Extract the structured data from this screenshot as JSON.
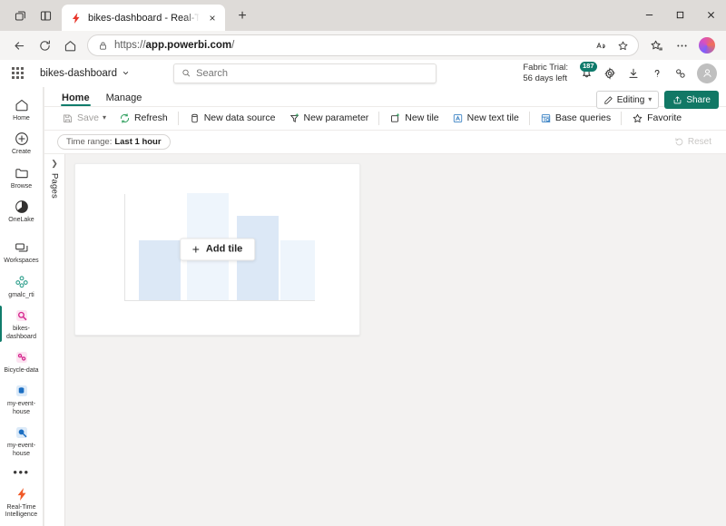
{
  "browser": {
    "tab_title": "bikes-dashboard - Real-Time Inte",
    "tab_favicon": "lightning-bolt-icon",
    "new_tab_label": "+",
    "close_label": "×",
    "url_prefix": "https://",
    "url_domain": "app.powerbi.com",
    "url_suffix": "/",
    "icons": {
      "collections": "collections-icon",
      "split_screen": "split-screen-icon",
      "back": "back-arrow-icon",
      "refresh": "reload-icon",
      "home": "home-icon",
      "lock": "lock-icon",
      "read_aloud": "read-aloud-icon",
      "favorite": "star-icon",
      "favorites_bar": "favorites-list-icon",
      "settings_more": "ellipsis-icon",
      "copilot": "copilot-icon",
      "minimize": "minimize-icon",
      "maximize": "maximize-icon",
      "close": "close-icon"
    }
  },
  "header": {
    "waffle": "app-launcher-icon",
    "breadcrumb": "bikes-dashboard",
    "breadcrumb_chevron": "chevron-down-icon",
    "search": {
      "placeholder": "Search",
      "value": "",
      "icon": "search-icon"
    },
    "trial_line1": "Fabric Trial:",
    "trial_line2": "56 days left",
    "notification_count": "187",
    "icons": {
      "notifications": "bell-icon",
      "settings": "gear-icon",
      "download": "download-icon",
      "help": "help-icon",
      "feedback": "feedback-icon",
      "account": "avatar-icon"
    }
  },
  "sidebar": {
    "items": [
      {
        "label": "Home",
        "icon": "home-icon",
        "selected": false
      },
      {
        "label": "Create",
        "icon": "plus-circle-icon",
        "selected": false
      },
      {
        "label": "Browse",
        "icon": "folder-icon",
        "selected": false
      },
      {
        "label": "OneLake",
        "icon": "onelake-icon",
        "selected": false
      },
      {
        "label": "Workspaces",
        "icon": "workspaces-icon",
        "selected": false
      },
      {
        "label": "gmalc_rti",
        "icon": "workspace-group-icon",
        "selected": false
      },
      {
        "label": "bikes-dashboard",
        "icon": "realtime-dashboard-icon",
        "selected": true
      },
      {
        "label": "Bicycle-data",
        "icon": "eventstream-icon",
        "selected": false
      },
      {
        "label": "my-event-house",
        "icon": "kql-database-icon",
        "selected": false
      },
      {
        "label": "my-event-house",
        "icon": "eventhouse-icon",
        "selected": false
      }
    ],
    "more_label": "•••",
    "footer": {
      "label": "Real-Time Intelligence",
      "icon": "lightning-bolt-icon"
    }
  },
  "tabs": [
    {
      "label": "Home",
      "active": true
    },
    {
      "label": "Manage",
      "active": false
    }
  ],
  "ribbon": {
    "groups": [
      {
        "buttons": [
          {
            "label": "Save",
            "icon": "save-icon",
            "disabled": true,
            "chevron": true
          },
          {
            "label": "Refresh",
            "icon": "refresh-icon",
            "disabled": false,
            "chevron": false
          }
        ]
      },
      {
        "buttons": [
          {
            "label": "New data source",
            "icon": "database-icon",
            "disabled": false,
            "chevron": false
          },
          {
            "label": "New parameter",
            "icon": "parameter-icon",
            "disabled": false,
            "chevron": false
          }
        ]
      },
      {
        "buttons": [
          {
            "label": "New tile",
            "icon": "new-tile-icon",
            "disabled": false,
            "chevron": false
          },
          {
            "label": "New text tile",
            "icon": "text-tile-icon",
            "disabled": false,
            "chevron": false
          }
        ]
      },
      {
        "buttons": [
          {
            "label": "Base queries",
            "icon": "base-queries-icon",
            "disabled": false,
            "chevron": false
          }
        ]
      },
      {
        "buttons": [
          {
            "label": "Favorite",
            "icon": "star-icon",
            "disabled": false,
            "chevron": false
          }
        ]
      }
    ]
  },
  "actions": {
    "editing_label": "Editing",
    "editing_icon": "pencil-icon",
    "editing_chevron": "chevron-down-icon",
    "share_label": "Share",
    "share_icon": "share-icon"
  },
  "filterbar": {
    "time_range_label": "Time range:",
    "time_range_value": "Last 1 hour",
    "reset_label": "Reset",
    "reset_icon": "reset-icon",
    "reset_disabled": true
  },
  "pages_panel": {
    "label": "Pages",
    "expand_icon": "chevron-right-icon"
  },
  "canvas": {
    "add_tile_label": "Add tile",
    "add_tile_icon": "plus-icon",
    "empty_state": {
      "bars": [
        {
          "height_pct": 56,
          "color": "#dce8f6"
        },
        {
          "height_pct": 100,
          "color": "#eef5fc"
        },
        {
          "height_pct": 79,
          "color": "#dce8f6"
        },
        {
          "height_pct": 56,
          "color": "#eef5fc"
        }
      ]
    }
  },
  "colors": {
    "accent_green": "#107c6b",
    "share_green": "#117865",
    "canvas_bg": "#f3f2f1",
    "chrome_bg": "#dedbd8"
  }
}
